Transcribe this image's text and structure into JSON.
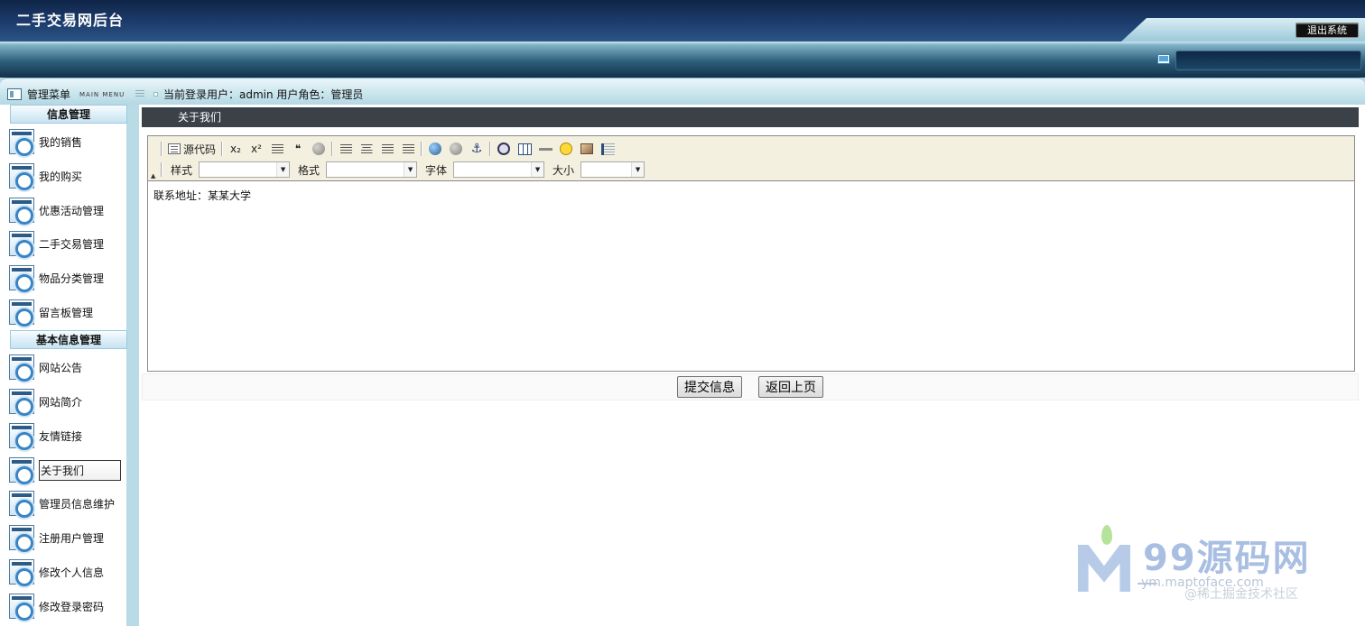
{
  "header": {
    "title": "二手交易网后台",
    "logout_label": "退出系统"
  },
  "frame": {
    "menu_label": "管理菜单",
    "menu_label_en": "MAIN MENU",
    "user_info": "当前登录用户：admin  用户角色：管理员"
  },
  "sidebar": {
    "sections": [
      {
        "title": "信息管理",
        "items": [
          "我的销售",
          "我的购买",
          "优惠活动管理",
          "二手交易管理",
          "物品分类管理",
          "留言板管理"
        ]
      },
      {
        "title": "基本信息管理",
        "items": [
          "网站公告",
          "网站简介",
          "友情链接",
          "关于我们",
          "管理员信息维护",
          "注册用户管理",
          "修改个人信息",
          "修改登录密码"
        ]
      }
    ],
    "active_item": "关于我们"
  },
  "main": {
    "page_title": "关于我们",
    "toolbar": {
      "source_label": "源代码",
      "subscript": "x₂",
      "superscript": "x²",
      "quote": "❝",
      "style_label": "样式",
      "format_label": "格式",
      "font_label": "字体",
      "size_label": "大小"
    },
    "content": "联系地址：某某大学",
    "submit_label": "提交信息",
    "back_label": "返回上页"
  },
  "watermark": {
    "brand": "99源码网",
    "url": "ym.maptoface.com",
    "credit": "@稀土掘金技术社区"
  },
  "colors": {
    "header_dark": "#1d3d6e",
    "frame_blue": "#b8dbe6",
    "title_bar": "#3b4149",
    "toolbar_bg": "#f3f0e0"
  }
}
